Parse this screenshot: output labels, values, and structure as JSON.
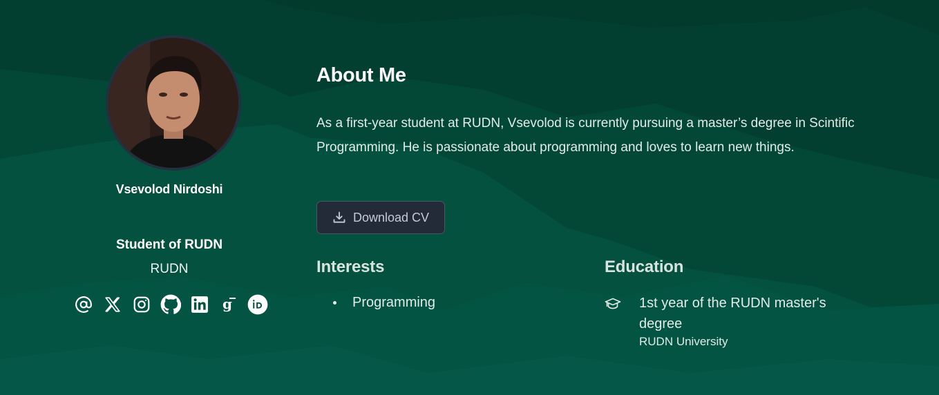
{
  "profile": {
    "name": "Vsevolod Nirdoshi",
    "role": "Student of RUDN",
    "organization": "RUDN",
    "avatar_alt": "photo",
    "socials": [
      {
        "icon": "at-sign-icon",
        "label": "Email"
      },
      {
        "icon": "x-twitter-icon",
        "label": "X"
      },
      {
        "icon": "instagram-icon",
        "label": "Instagram"
      },
      {
        "icon": "github-icon",
        "label": "GitHub"
      },
      {
        "icon": "linkedin-icon",
        "label": "LinkedIn"
      },
      {
        "icon": "google-scholar-icon",
        "label": "Google Scholar"
      },
      {
        "icon": "orcid-icon",
        "label": "ORCID"
      }
    ]
  },
  "about": {
    "title": "About Me",
    "text": "As a first-year student at RUDN, Vsevolod is currently pursuing a master’s degree in Scintific Programming. He is passionate about programming and loves to learn new things.",
    "download_button": {
      "label": "Download CV",
      "icon": "download-icon"
    }
  },
  "interests": {
    "title": "Interests",
    "items": [
      "Programming"
    ]
  },
  "education": {
    "title": "Education",
    "items": [
      {
        "icon": "graduation-cap-icon",
        "degree": "1st year of the RUDN master's degree",
        "institution": "RUDN University"
      }
    ]
  },
  "colors": {
    "background": "#04513f",
    "background_dark": "#023a2c",
    "button_bg": "#242b38",
    "text": "#ffffff"
  }
}
